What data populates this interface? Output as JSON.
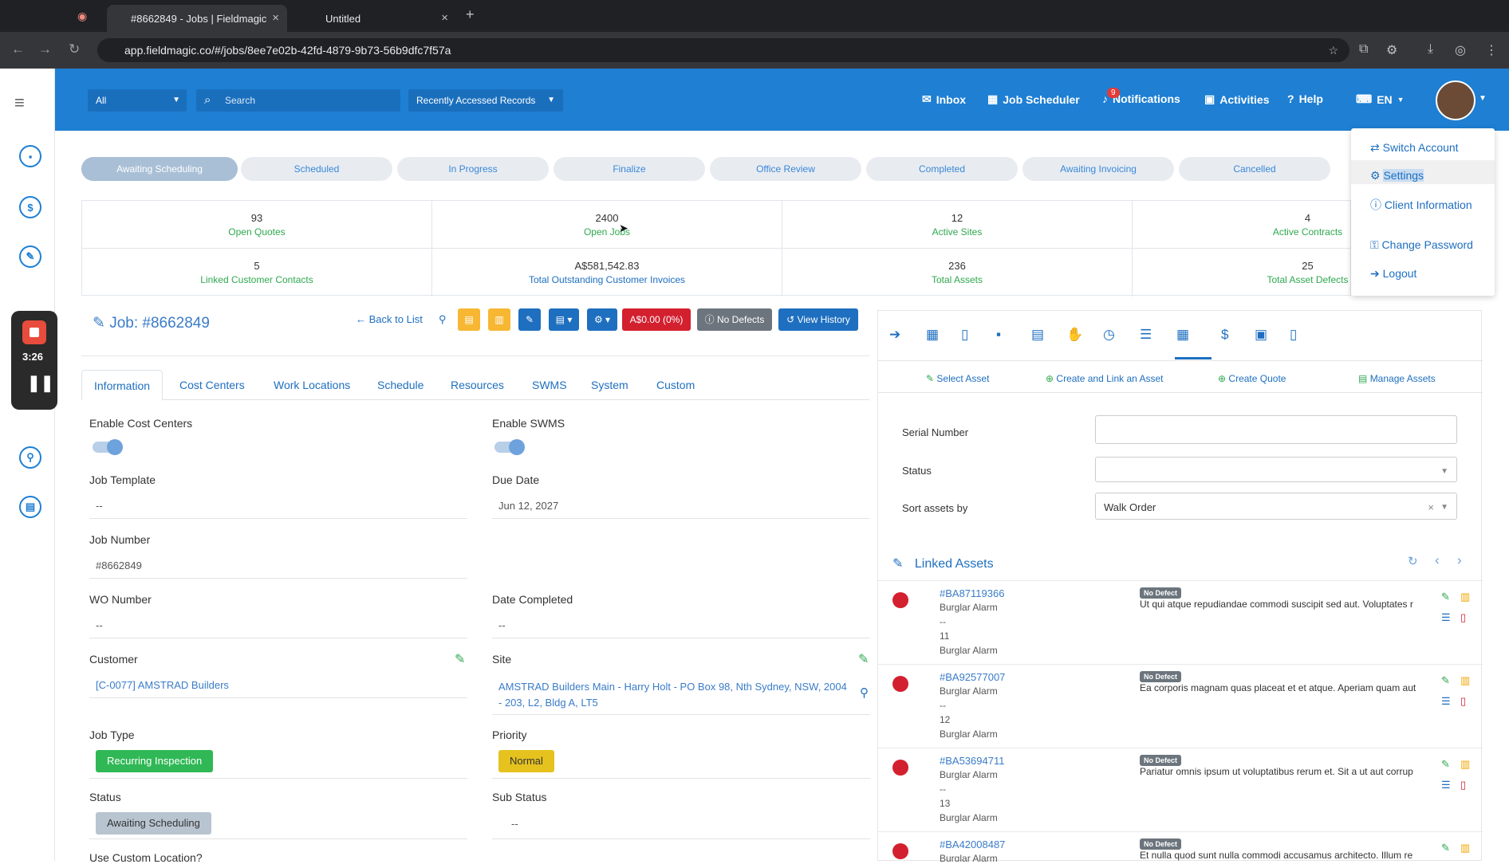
{
  "browser": {
    "tabs": [
      {
        "title": "#8662849 - Jobs | Fieldmagic"
      },
      {
        "title": "Untitled"
      }
    ],
    "url": "app.fieldmagic.co/#/jobs/8ee7e02b-42fd-4879-9b73-56b9dfc7f57a"
  },
  "appbar": {
    "filter": "All",
    "search_placeholder": "Search",
    "recent": "Recently Accessed Records",
    "nav": {
      "inbox": "Inbox",
      "scheduler": "Job Scheduler",
      "notifications": "Notifications",
      "notif_count": "9",
      "activities": "Activities",
      "help": "Help",
      "lang": "EN"
    }
  },
  "user_menu": {
    "items": [
      "Switch Account",
      "Settings",
      "Client Information",
      "Change Password",
      "Logout"
    ]
  },
  "stages": [
    "Awaiting Scheduling",
    "Scheduled",
    "In Progress",
    "Finalize",
    "Office Review",
    "Completed",
    "Awaiting Invoicing",
    "Cancelled"
  ],
  "stats": [
    {
      "num": "93",
      "label": "Open Quotes"
    },
    {
      "num": "2400",
      "label": "Open Jobs"
    },
    {
      "num": "12",
      "label": "Active Sites"
    },
    {
      "num": "4",
      "label": "Active Contracts"
    },
    {
      "num": "5",
      "label": "Linked Customer Contacts"
    },
    {
      "num": "A$581,542.83",
      "label": "Total Outstanding Customer Invoices"
    },
    {
      "num": "236",
      "label": "Total Assets"
    },
    {
      "num": "25",
      "label": "Total Asset Defects"
    }
  ],
  "job": {
    "title": "Job: #8662849",
    "back": "Back to List",
    "amount": "A$0.00 (0%)",
    "defects": "No Defects",
    "history": "View History"
  },
  "tabs": [
    "Information",
    "Cost Centers",
    "Work Locations",
    "Schedule",
    "Resources",
    "SWMS",
    "System",
    "Custom"
  ],
  "fields": {
    "enable_cost_centers": "Enable Cost Centers",
    "enable_swms": "Enable SWMS",
    "job_template_label": "Job Template",
    "job_template": "--",
    "due_date_label": "Due Date",
    "due_date": "Jun 12, 2027",
    "job_number_label": "Job Number",
    "job_number": "#8662849",
    "wo_number_label": "WO Number",
    "wo_number": "--",
    "date_completed_label": "Date Completed",
    "date_completed": "--",
    "customer_label": "Customer",
    "customer": "[C-0077] AMSTRAD Builders",
    "site_label": "Site",
    "site_line1": "AMSTRAD Builders Main - Harry Holt - PO Box 98, Nth Sydney, NSW, 2004",
    "site_line2": "- 203, L2, Bldg A, LT5",
    "job_type_label": "Job Type",
    "job_type": "Recurring Inspection",
    "priority_label": "Priority",
    "priority": "Normal",
    "status_label": "Status",
    "status": "Awaiting Scheduling",
    "sub_status_label": "Sub Status",
    "sub_status": "--",
    "custom_location_label": "Use Custom Location?"
  },
  "assets_panel": {
    "actions": [
      "Select Asset",
      "Create and Link an Asset",
      "Create Quote",
      "Manage Assets"
    ],
    "serial_label": "Serial Number",
    "status_label": "Status",
    "sort_label": "Sort assets by",
    "sort_value": "Walk Order",
    "linked_title": "Linked Assets",
    "badge": "No Defect",
    "assets": [
      {
        "id": "#BA87119366",
        "type": "Burglar Alarm",
        "dash": "--",
        "num": "11",
        "type2": "Burglar Alarm",
        "desc": "Ut qui atque repudiandae commodi suscipit sed aut. Voluptates r"
      },
      {
        "id": "#BA92577007",
        "type": "Burglar Alarm",
        "dash": "--",
        "num": "12",
        "type2": "Burglar Alarm",
        "desc": "Ea corporis magnam quas placeat et et atque. Aperiam quam aut"
      },
      {
        "id": "#BA53694711",
        "type": "Burglar Alarm",
        "dash": "--",
        "num": "13",
        "type2": "Burglar Alarm",
        "desc": "Pariatur omnis ipsum ut voluptatibus rerum et. Sit a ut aut corrup"
      },
      {
        "id": "#BA42008487",
        "type": "Burglar Alarm",
        "dash": "",
        "num": "",
        "type2": "",
        "desc": "Et nulla quod sunt nulla commodi accusamus architecto. Illum re"
      }
    ]
  },
  "recorder": {
    "time": "3:26"
  }
}
